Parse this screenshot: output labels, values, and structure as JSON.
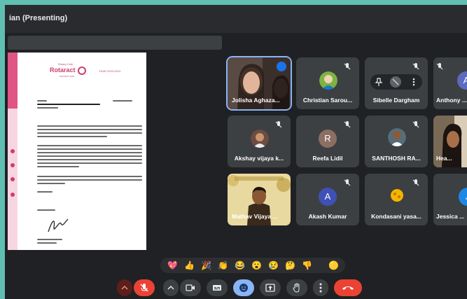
{
  "presenter_title": "ian (Presenting)",
  "document": {
    "logo_small": "Rotary Club",
    "logo": "Rotaract",
    "logo_sub": "DISTRICT 3232",
    "year": "YEAR 2023-2024"
  },
  "participants": [
    {
      "name": "Jolisha Aghaza...",
      "kind": "video",
      "speaking": true
    },
    {
      "name": "Christian Sarou...",
      "kind": "photo",
      "muted": true
    },
    {
      "name": "Sibelle Dargham",
      "kind": "avatar",
      "muted": true
    },
    {
      "name": "Anthony ...",
      "kind": "avatar",
      "initial": "A",
      "color": "#5c6bc0",
      "muted": true
    },
    {
      "name": "Akshay vijaya k...",
      "kind": "photo",
      "muted": true
    },
    {
      "name": "Reefa Lidil",
      "kind": "avatar",
      "initial": "R",
      "color": "#8d6e63",
      "muted": true
    },
    {
      "name": "SANTHOSH RA...",
      "kind": "photo",
      "muted": true
    },
    {
      "name": "Hea...",
      "kind": "video"
    },
    {
      "name": "Mathav Vijaya ...",
      "kind": "video"
    },
    {
      "name": "Akash Kumar",
      "kind": "avatar",
      "initial": "A",
      "color": "#3f51b5",
      "muted": true
    },
    {
      "name": "Kondasani yasa...",
      "kind": "photo",
      "muted": true
    },
    {
      "name": "Jessica ...",
      "kind": "avatar",
      "initial": "J",
      "color": "#1e88e5"
    }
  ],
  "reactions": [
    "💖",
    "👍",
    "🎉",
    "👏",
    "😂",
    "😮",
    "😢",
    "🤔",
    "👎",
    "🟡"
  ],
  "controls": [
    "expand-caret",
    "mic-off",
    "more-caret",
    "camera",
    "captions",
    "emoji",
    "present",
    "raise-hand",
    "more-options",
    "leave-call"
  ],
  "colors": {
    "background": "#202124",
    "tile": "#3c4043",
    "accent": "#8ab4f8",
    "leave": "#ea4335",
    "frame": "#5fbfb3"
  }
}
